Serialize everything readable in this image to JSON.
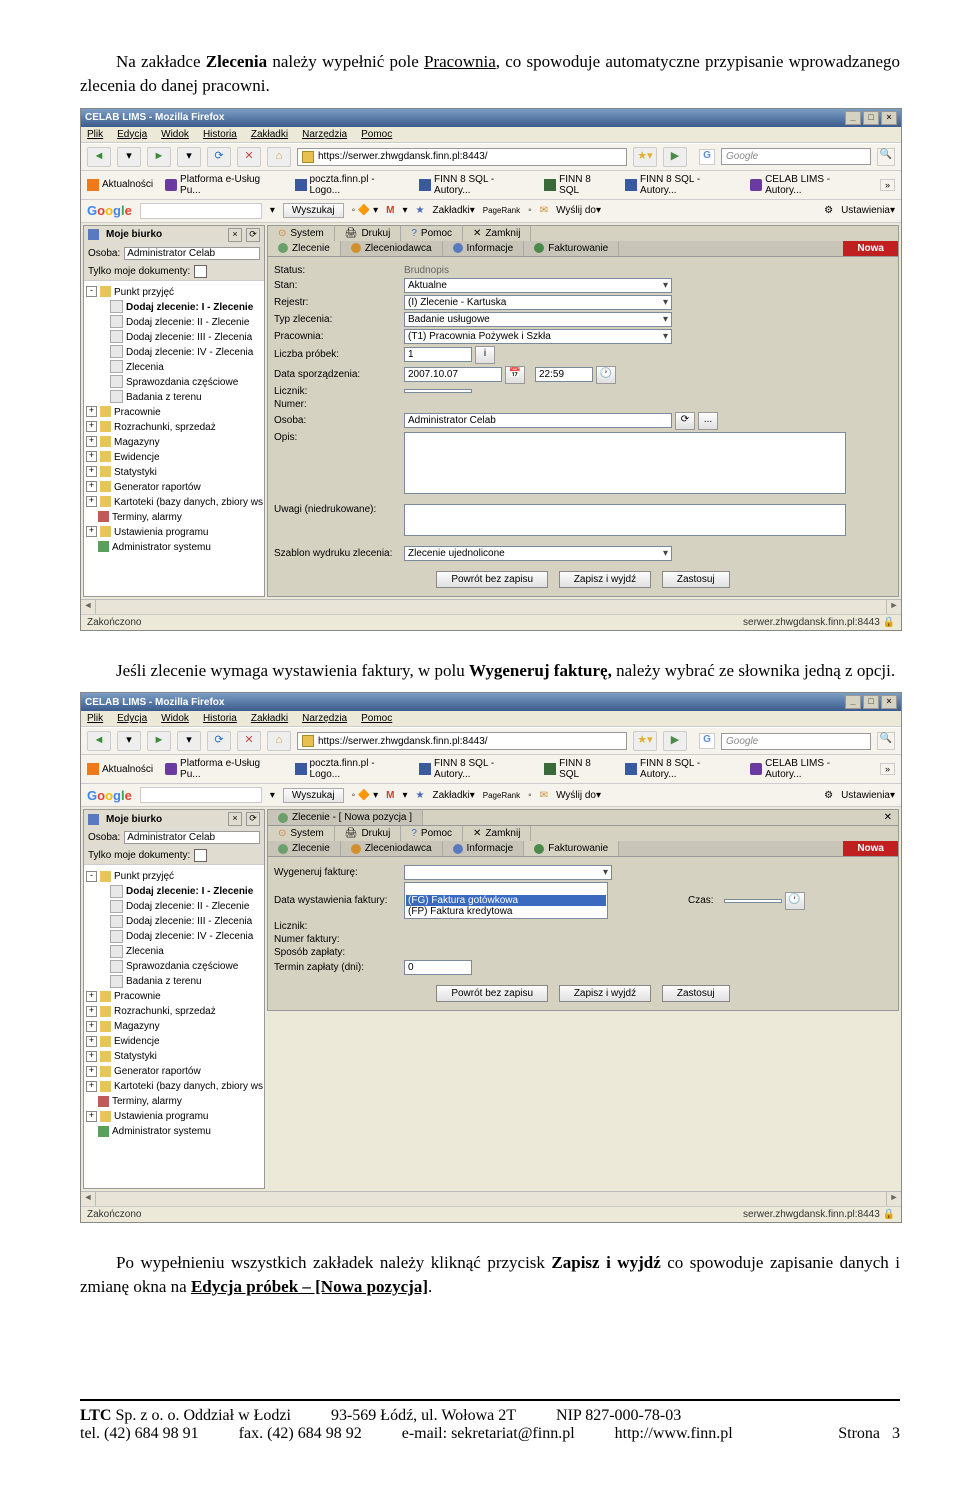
{
  "para1_a": "Na zakładce ",
  "para1_b": "Zlecenia",
  "para1_c": " należy wypełnić pole ",
  "para1_d": "Pracownia",
  "para1_e": ", co spowoduje automatyczne przypisanie wprowadzanego zlecenia do danej pracowni.",
  "para2_a": "Jeśli zlecenie wymaga wystawienia faktury, w polu ",
  "para2_b": "Wygeneruj fakturę,",
  "para2_c": " należy wybrać ze słownika jedną z opcji.",
  "para3_a": "Po wypełnieniu wszystkich zakładek należy kliknąć przycisk ",
  "para3_b": "Zapisz i wyjdź",
  "para3_c": " co spowoduje zapisanie danych i zmianę okna na ",
  "para3_d": "Edycja próbek – [Nowa pozycja]",
  "para3_e": ".",
  "win": {
    "title": "CELAB LIMS - Mozilla Firefox",
    "menu": [
      "Plik",
      "Edycja",
      "Widok",
      "Historia",
      "Zakładki",
      "Narzędzia",
      "Pomoc"
    ],
    "url": "https://serwer.zhwgdansk.finn.pl:8443/",
    "search_ph": "Google",
    "bookmarks": [
      "Aktualności",
      "Platforma e-Usług Pu...",
      "poczta.finn.pl - Logo...",
      "FINN 8 SQL - Autory...",
      "FINN 8 SQL",
      "FINN 8 SQL - Autory...",
      "CELAB LIMS - Autory..."
    ],
    "g_search": "Wyszukaj",
    "g_zak": "Zakładki▾",
    "g_pr": "PageRank",
    "g_wy": "Wyślij do▾",
    "g_ust": "Ustawienia▾",
    "status_left": "Zakończono",
    "status_right": "serwer.zhwgdansk.finn.pl:8443"
  },
  "tree": {
    "biurko": "Moje biurko",
    "os_lbl": "Osoba:",
    "os_val": "Administrator Celab",
    "tylko": "Tylko moje dokumenty:",
    "items": [
      "Punkt przyjęć",
      "Dodaj zlecenie: I - Zlecenie",
      "Dodaj zlecenie: II - Zlecenie",
      "Dodaj zlecenie: III - Zlecenia",
      "Dodaj zlecenie: IV - Zlecenia",
      "Zlecenia",
      "Sprawozdania częściowe",
      "Badania z terenu",
      "Pracownie",
      "Rozrachunki, sprzedaż",
      "Magazyny",
      "Ewidencje",
      "Statystyki",
      "Generator raportów",
      "Kartoteki (bazy danych, zbiory ws",
      "Terminy, alarmy",
      "Ustawienia programu",
      "Administrator systemu"
    ]
  },
  "toolbar": {
    "sys": "System",
    "druk": "Drukuj",
    "pom": "Pomoc",
    "zam": "Zamknij"
  },
  "subtabs": {
    "zl": "Zlecenie",
    "zd": "Zleceniodawca",
    "inf": "Informacje",
    "fak": "Fakturowanie",
    "nowa": "Nowa"
  },
  "form1": {
    "status_l": "Status:",
    "status_v": "Brudnopis",
    "stan_l": "Stan:",
    "stan_v": "Aktualne",
    "rej_l": "Rejestr:",
    "rej_v": "(I) Zlecenie - Kartuska",
    "typ_l": "Typ zlecenia:",
    "typ_v": "Badanie usługowe",
    "prac_l": "Pracownia:",
    "prac_v": "(T1) Pracownia Pożywek i Szkła",
    "lp_l": "Liczba próbek:",
    "lp_v": "1",
    "dsp_l": "Data sporządzenia:",
    "dsp_d": "2007.10.07",
    "dsp_t": "22:59",
    "lic_l": "Licznik:",
    "num_l": "Numer:",
    "oso_l": "Osoba:",
    "oso_v": "Administrator Celab",
    "op_l": "Opis:",
    "uw_l": "Uwagi (niedrukowane):",
    "sz_l": "Szablon wydruku zlecenia:",
    "sz_v": "Zlecenie ujednolicone"
  },
  "tab2_title": "Zlecenie - [ Nowa pozycja ]",
  "form2": {
    "wg_l": "Wygeneruj fakturę:",
    "dw_l": "Data wystawienia faktury:",
    "opt1": "(FG) Faktura gotówkowa",
    "opt2": "(FP) Faktura kredytowa",
    "cz_l": "Czas:",
    "lic_l": "Licznik:",
    "nf_l": "Numer faktury:",
    "sp_l": "Sposób zapłaty:",
    "tz_l": "Termin zapłaty (dni):",
    "tz_v": "0"
  },
  "btns": {
    "p": "Powrót bez zapisu",
    "z": "Zapisz i wyjdź",
    "za": "Zastosuj"
  },
  "foot": {
    "l1a": "LTC",
    "l1b": " Sp. z o. o. Oddział w Łodzi",
    "l1c": "93-569 Łódź, ul. Wołowa 2T",
    "l1d": "NIP 827-000-78-03",
    "l2a": "tel. (42) 684 98 91",
    "l2b": "fax. (42) 684 98 92",
    "l2c": "e-mail: sekretariat@finn.pl",
    "l2d": "http://www.finn.pl",
    "l2e": "Strona",
    "l2f": "3"
  }
}
